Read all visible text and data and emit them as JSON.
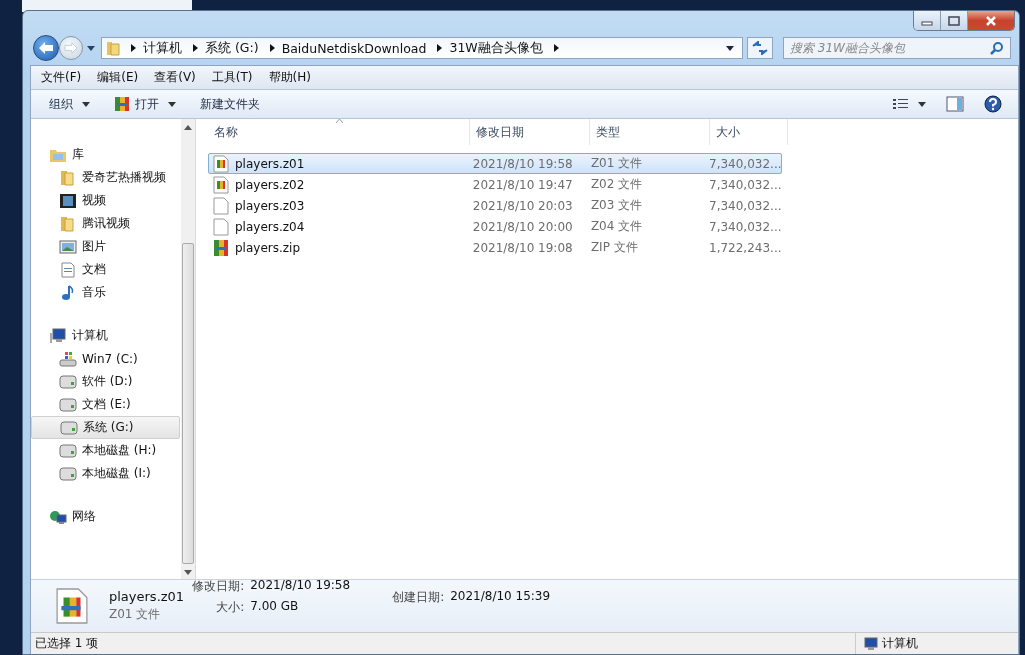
{
  "address": {
    "segments": [
      "计算机",
      "系统 (G:)",
      "BaiduNetdiskDownload",
      "31W融合头像包"
    ]
  },
  "search": {
    "placeholder": "搜索 31W融合头像包"
  },
  "menu": [
    "文件(F)",
    "编辑(E)",
    "查看(V)",
    "工具(T)",
    "帮助(H)"
  ],
  "toolbar": [
    {
      "label": "组织",
      "kind": "plain",
      "dropdown": true
    },
    {
      "label": "打开",
      "kind": "archive",
      "dropdown": true
    },
    {
      "label": "新建文件夹",
      "kind": "plain",
      "dropdown": false
    }
  ],
  "nav": [
    {
      "label": "库",
      "kind": "library",
      "selected": false,
      "children": [
        {
          "label": "爱奇艺热播视频",
          "kind": "folder",
          "selected": false
        },
        {
          "label": "视频",
          "kind": "film",
          "selected": false
        },
        {
          "label": "腾讯视频",
          "kind": "folder",
          "selected": false
        },
        {
          "label": "图片",
          "kind": "image",
          "selected": false
        },
        {
          "label": "文档",
          "kind": "document",
          "selected": false
        },
        {
          "label": "音乐",
          "kind": "music",
          "selected": false
        }
      ]
    },
    {
      "label": "计算机",
      "kind": "computer",
      "selected": false,
      "children": [
        {
          "label": "Win7 (C:)",
          "kind": "system-drive",
          "selected": false
        },
        {
          "label": "软件 (D:)",
          "kind": "drive",
          "selected": false
        },
        {
          "label": "文档 (E:)",
          "kind": "drive",
          "selected": false
        },
        {
          "label": "系统 (G:)",
          "kind": "drive",
          "selected": true
        },
        {
          "label": "本地磁盘 (H:)",
          "kind": "drive",
          "selected": false
        },
        {
          "label": "本地磁盘 (I:)",
          "kind": "drive",
          "selected": false
        }
      ]
    },
    {
      "label": "网络",
      "kind": "network",
      "selected": false
    }
  ],
  "table": {
    "columns": [
      "名称",
      "修改日期",
      "类型",
      "大小"
    ],
    "rows": [
      {
        "name": "players.z01",
        "modified": "2021/8/10 19:58",
        "type": "Z01 文件",
        "size": "7,340,032...",
        "kind": "archive-page",
        "selected": true
      },
      {
        "name": "players.z02",
        "modified": "2021/8/10 19:47",
        "type": "Z02 文件",
        "size": "7,340,032...",
        "kind": "archive-page",
        "selected": false
      },
      {
        "name": "players.z03",
        "modified": "2021/8/10 20:03",
        "type": "Z03 文件",
        "size": "7,340,032...",
        "kind": "blank",
        "selected": false
      },
      {
        "name": "players.z04",
        "modified": "2021/8/10 20:00",
        "type": "Z04 文件",
        "size": "7,340,032...",
        "kind": "blank",
        "selected": false
      },
      {
        "name": "players.zip",
        "modified": "2021/8/10 19:08",
        "type": "ZIP 文件",
        "size": "1,722,243...",
        "kind": "archive",
        "selected": false
      }
    ]
  },
  "details": {
    "name": "players.z01",
    "type": "Z01 文件",
    "modified_label": "修改日期:",
    "modified": "2021/8/10 19:58",
    "size_label": "大小:",
    "size": "7.00 GB",
    "created_label": "创建日期:",
    "created": "2021/8/10 15:39"
  },
  "status_bar": {
    "selection": "已选择 1 项",
    "location": "计算机"
  }
}
